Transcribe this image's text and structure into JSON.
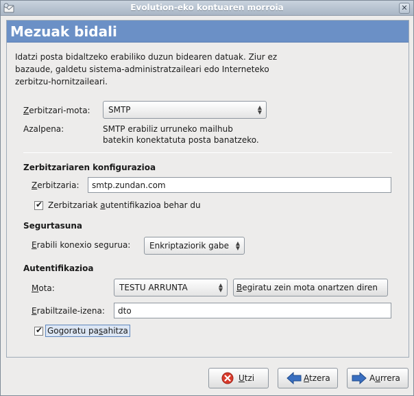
{
  "window": {
    "title": "Evolution-eko kontuaren morroia",
    "icon": "mail-icon",
    "close_icon": "close-icon"
  },
  "page": {
    "title": "Mezuak bidali",
    "intro": "Idatzi posta bidaltzeko erabiliko duzun bidearen datuak. Ziur ez bazaude, galdetu sistema-administratzaileari edo Interneteko zerbitzu-hornitzaileari."
  },
  "server_type": {
    "label_mnemonic": "Z",
    "label_rest": "erbitzari-mota:",
    "value": "SMTP",
    "desc_label": "Azalpena:",
    "desc_line1": "SMTP erabiliz urruneko mailhub",
    "desc_line2": "batekin konektatuta posta banatzeko."
  },
  "server_config": {
    "heading": "Zerbitzariaren konfigurazioa",
    "server_label_mnemonic": "Z",
    "server_label_rest": "erbitzaria:",
    "server_value": "smtp.zundan.com",
    "auth_check_pre": "Zerbitzariak ",
    "auth_check_mnemonic": "a",
    "auth_check_post": "utentifikazioa behar du",
    "auth_checked": true
  },
  "security": {
    "heading": "Segurtasuna",
    "label_mnemonic": "E",
    "label_rest": "rabili konexio segurua:",
    "value": "Enkriptaziorik gabe"
  },
  "authentication": {
    "heading": "Autentifikazioa",
    "type_label_mnemonic": "M",
    "type_label_rest": "ota:",
    "type_value": "TESTU ARRUNTA",
    "check_button_mnemonic": "B",
    "check_button_rest": "egiratu zein mota onartzen diren",
    "username_label_mnemonic": "E",
    "username_label_rest": "rabiltzaile-izena:",
    "username_value": "dto",
    "remember_pre": "Gogoratu pa",
    "remember_mnemonic": "s",
    "remember_post": "ahitza",
    "remember_checked": true
  },
  "buttons": {
    "cancel_mnemonic": "U",
    "cancel_rest": "tzi",
    "back_mnemonic": "A",
    "back_rest": "tzera",
    "forward_pre": "A",
    "forward_mnemonic": "u",
    "forward_rest": "rrera"
  },
  "colors": {
    "header": "#6b90c6",
    "cancel": "#d83a2b",
    "arrow": "#3a6fc0"
  }
}
